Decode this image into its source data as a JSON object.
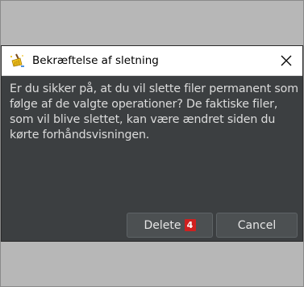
{
  "dialog": {
    "title": "Bekræftelse af sletning",
    "message": "Er du sikker på, at du vil slette filer permanent som følge af de valgte operationer? De faktiske filer, som vil blive slettet, kan være ændret siden du kørte forhåndsvisningen.",
    "icons": {
      "app": "broom-icon",
      "close": "close-icon"
    },
    "buttons": {
      "delete_label": "Delete",
      "delete_count": "4",
      "cancel_label": "Cancel"
    },
    "colors": {
      "background": "#3c3f41",
      "titlebar": "#ffffff",
      "badge": "#d0201f"
    }
  }
}
